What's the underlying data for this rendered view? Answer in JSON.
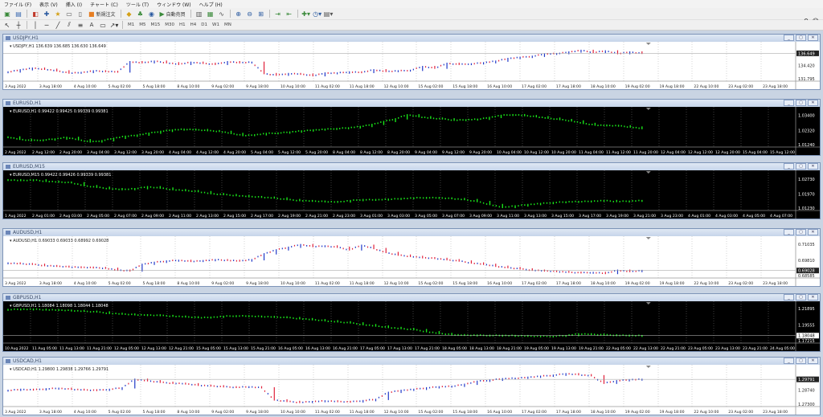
{
  "menu": [
    "ファイル (F)",
    "表示 (V)",
    "挿入 (I)",
    "チャート (C)",
    "ツール (T)",
    "ウィンドウ (W)",
    "ヘルプ (H)"
  ],
  "toolbar": {
    "new_order": "新規注文",
    "auto_trade": "自動売買",
    "timeframes": [
      "M1",
      "M5",
      "M15",
      "M30",
      "H1",
      "H4",
      "D1",
      "W1",
      "MN"
    ]
  },
  "charts": [
    {
      "title": "USDJPY,H1",
      "ohlc_label": "USDJPY,H1  136.639 136.685 136.630 136.649",
      "theme": "white",
      "prices": [
        "136.649",
        "134.420",
        "131.795"
      ],
      "current_price": "136.649",
      "x_labels": [
        "3 Aug 2022",
        "3 Aug 18:00",
        "4 Aug 10:00",
        "5 Aug 02:00",
        "5 Aug 18:00",
        "8 Aug 10:00",
        "9 Aug 02:00",
        "9 Aug 18:00",
        "10 Aug 10:00",
        "11 Aug 02:00",
        "11 Aug 18:00",
        "12 Aug 10:00",
        "15 Aug 02:00",
        "15 Aug 18:00",
        "16 Aug 10:00",
        "17 Aug 02:00",
        "17 Aug 18:00",
        "18 Aug 10:00",
        "19 Aug 02:00",
        "19 Aug 18:00",
        "22 Aug 10:00",
        "23 Aug 02:00",
        "23 Aug 18:00"
      ],
      "chart_data": {
        "type": "line",
        "series": [
          {
            "values": [
              133.2,
              133.6,
              133.9,
              133.7,
              133.4,
              133.0,
              133.1,
              133.4,
              133.3,
              133.2,
              135.1,
              134.9,
              135.2,
              134.9,
              134.6,
              135.0,
              134.8,
              134.6,
              135.1,
              134.9,
              135.0,
              132.9,
              132.6,
              132.9,
              132.8,
              132.5,
              133.0,
              133.0,
              133.2,
              133.1,
              133.6,
              133.3,
              133.4,
              133.5,
              134.2,
              133.9,
              134.8,
              134.6,
              134.7,
              134.9,
              135.2,
              135.7,
              135.9,
              136.1,
              136.5,
              136.6,
              136.9,
              137.2,
              136.8,
              137.1,
              136.6,
              136.9,
              136.649
            ]
          }
        ],
        "ylim": [
          131.795,
          137.6
        ]
      }
    },
    {
      "title": "EURUSD,H1",
      "ohlc_label": "EURUSD,H1  0.99422 0.99425 0.99339 0.99381",
      "theme": "black",
      "prices": [
        "1.03400",
        "1.02320",
        "1.01240"
      ],
      "current_price": "",
      "x_labels": [
        "2 Aug 2022",
        "2 Aug 12:00",
        "2 Aug 20:00",
        "3 Aug 04:00",
        "3 Aug 12:00",
        "3 Aug 20:00",
        "4 Aug 04:00",
        "4 Aug 12:00",
        "4 Aug 20:00",
        "5 Aug 04:00",
        "5 Aug 12:00",
        "5 Aug 20:00",
        "8 Aug 04:00",
        "8 Aug 12:00",
        "8 Aug 20:00",
        "9 Aug 04:00",
        "9 Aug 12:00",
        "9 Aug 20:00",
        "10 Aug 04:00",
        "10 Aug 12:00",
        "10 Aug 20:00",
        "11 Aug 04:00",
        "11 Aug 12:00",
        "11 Aug 20:00",
        "12 Aug 04:00",
        "12 Aug 12:00",
        "12 Aug 20:00",
        "15 Aug 04:00",
        "15 Aug 12:00"
      ],
      "chart_data": {
        "type": "line",
        "series": [
          {
            "values": [
              1.0185,
              1.0168,
              1.0159,
              1.0163,
              1.017,
              1.0182,
              1.0165,
              1.0149,
              1.0158,
              1.0175,
              1.019,
              1.0198,
              1.0212,
              1.0225,
              1.0235,
              1.024,
              1.0238,
              1.023,
              1.0225,
              1.021,
              1.0195,
              1.02,
              1.021,
              1.0213,
              1.022,
              1.0228,
              1.0235,
              1.024,
              1.0245,
              1.025,
              1.026,
              1.0275,
              1.0296,
              1.0315,
              1.0344,
              1.033,
              1.032,
              1.0315,
              1.0305,
              1.0308,
              1.0312,
              1.0325,
              1.034,
              1.0345,
              1.0338,
              1.033,
              1.032,
              1.031,
              1.03,
              1.0282,
              1.027,
              1.0268,
              1.0265,
              1.0256,
              1.0245
            ]
          }
        ],
        "ylim": [
          1.0124,
          1.0355
        ]
      }
    },
    {
      "title": "EURUSD,M15",
      "ohlc_label": "EURUSD,M15  0.99422 0.99426 0.99339 0.99381",
      "theme": "black",
      "prices": [
        "1.02730",
        "1.01970",
        "1.01230"
      ],
      "current_price": "",
      "x_labels": [
        "1 Aug 2022",
        "2 Aug 01:00",
        "2 Aug 03:00",
        "2 Aug 05:00",
        "2 Aug 07:00",
        "2 Aug 09:00",
        "2 Aug 11:00",
        "2 Aug 13:00",
        "2 Aug 15:00",
        "2 Aug 17:00",
        "2 Aug 19:00",
        "2 Aug 21:00",
        "2 Aug 23:00",
        "3 Aug 01:00",
        "3 Aug 03:00",
        "3 Aug 05:00",
        "3 Aug 07:00",
        "3 Aug 09:00",
        "3 Aug 11:00",
        "3 Aug 13:00",
        "3 Aug 15:00",
        "3 Aug 17:00",
        "3 Aug 19:00",
        "3 Aug 21:00",
        "3 Aug 23:00",
        "4 Aug 01:00",
        "4 Aug 03:00",
        "4 Aug 05:00",
        "4 Aug 07:00"
      ],
      "chart_data": {
        "type": "line",
        "series": [
          {
            "values": [
              1.027,
              1.0266,
              1.0269,
              1.0262,
              1.0258,
              1.0255,
              1.024,
              1.0232,
              1.0225,
              1.022,
              1.0225,
              1.0235,
              1.0228,
              1.022,
              1.0215,
              1.021,
              1.02,
              1.0195,
              1.019,
              1.0185,
              1.0182,
              1.0178,
              1.017,
              1.0165,
              1.0162,
              1.016,
              1.0158,
              1.0165,
              1.017,
              1.0168,
              1.0172,
              1.0175,
              1.0178,
              1.018,
              1.0178,
              1.0175,
              1.017,
              1.016,
              1.0145,
              1.013,
              1.0138,
              1.0145,
              1.015,
              1.0155,
              1.0158,
              1.016,
              1.0162,
              1.0165,
              1.016,
              1.0162,
              1.0165
            ]
          }
        ],
        "ylim": [
          1.0123,
          1.0285
        ]
      }
    },
    {
      "title": "AUDUSD,H1",
      "ohlc_label": "AUDUSD,H1  0.69033 0.69033 0.68992 0.69028",
      "theme": "white",
      "prices": [
        "0.71035",
        "0.69810",
        "0.69028",
        "0.68585"
      ],
      "current_price": "0.69028",
      "x_labels": [
        "3 Aug 2022",
        "3 Aug 18:00",
        "4 Aug 10:00",
        "5 Aug 02:00",
        "5 Aug 18:00",
        "8 Aug 10:00",
        "9 Aug 02:00",
        "9 Aug 18:00",
        "10 Aug 10:00",
        "11 Aug 02:00",
        "11 Aug 18:00",
        "12 Aug 10:00",
        "15 Aug 02:00",
        "15 Aug 18:00",
        "16 Aug 10:00",
        "17 Aug 02:00",
        "17 Aug 18:00",
        "18 Aug 10:00",
        "19 Aug 02:00",
        "19 Aug 18:00",
        "22 Aug 10:00",
        "23 Aug 02:00",
        "23 Aug 18:00"
      ],
      "chart_data": {
        "type": "line",
        "series": [
          {
            "values": [
              0.696,
              0.6955,
              0.695,
              0.694,
              0.6935,
              0.693,
              0.6928,
              0.6925,
              0.692,
              0.6905,
              0.69,
              0.695,
              0.6965,
              0.6975,
              0.698,
              0.6972,
              0.6978,
              0.6985,
              0.698,
              0.6975,
              0.6985,
              0.703,
              0.706,
              0.708,
              0.71,
              0.7085,
              0.709,
              0.708,
              0.706,
              0.7095,
              0.707,
              0.704,
              0.702,
              0.701,
              0.7,
              0.6995,
              0.6985,
              0.6975,
              0.696,
              0.695,
              0.6935,
              0.6925,
              0.6915,
              0.6905,
              0.69,
              0.6895,
              0.689,
              0.6885,
              0.6888,
              0.688,
              0.6905,
              0.6895,
              0.69028
            ]
          }
        ],
        "ylim": [
          0.6858,
          0.7115
        ]
      }
    },
    {
      "title": "GBPUSD,H1",
      "ohlc_label": "GBPUSD,H1  1.18084 1.18098 1.18044 1.18048",
      "theme": "black",
      "prices": [
        "1.21895",
        "1.19555",
        "1.18048",
        "1.17215"
      ],
      "current_price": "1.18048",
      "x_labels": [
        "10 Aug 2022",
        "11 Aug 05:00",
        "11 Aug 13:00",
        "11 Aug 21:00",
        "12 Aug 05:00",
        "12 Aug 13:00",
        "12 Aug 21:00",
        "15 Aug 05:00",
        "15 Aug 13:00",
        "15 Aug 21:00",
        "16 Aug 05:00",
        "16 Aug 13:00",
        "16 Aug 21:00",
        "17 Aug 05:00",
        "17 Aug 13:00",
        "17 Aug 21:00",
        "18 Aug 05:00",
        "18 Aug 13:00",
        "18 Aug 21:00",
        "19 Aug 05:00",
        "19 Aug 13:00",
        "19 Aug 21:00",
        "22 Aug 05:00",
        "22 Aug 13:00",
        "22 Aug 21:00",
        "23 Aug 05:00",
        "23 Aug 13:00",
        "23 Aug 21:00",
        "24 Aug 05:00"
      ],
      "chart_data": {
        "type": "line",
        "series": [
          {
            "values": [
              1.2175,
              1.218,
              1.2178,
              1.2172,
              1.2165,
              1.216,
              1.215,
              1.214,
              1.212,
              1.211,
              1.21,
              1.2098,
              1.209,
              1.208,
              1.207,
              1.206,
              1.2065,
              1.2078,
              1.2085,
              1.208,
              1.2075,
              1.207,
              1.206,
              1.2045,
              1.203,
              1.2015,
              1.2,
              1.1985,
              1.196,
              1.194,
              1.192,
              1.1905,
              1.189,
              1.186,
              1.1835,
              1.1818,
              1.1812,
              1.181,
              1.1808,
              1.1806,
              1.1805,
              1.18,
              1.1795,
              1.1798,
              1.1805,
              1.183,
              1.1825,
              1.1815,
              1.181,
              1.1805,
              1.18048
            ]
          }
        ],
        "ylim": [
          1.1722,
          1.22
        ]
      }
    },
    {
      "title": "USDCAD,H1",
      "ohlc_label": "USDCAD,H1  1.29800 1.29838 1.29766 1.29791",
      "theme": "white",
      "prices": [
        "1.29791",
        "1.28740",
        "1.27300"
      ],
      "current_price": "1.29791",
      "x_labels": [
        "3 Aug 2022",
        "3 Aug 18:00",
        "4 Aug 10:00",
        "5 Aug 02:00",
        "5 Aug 18:00",
        "8 Aug 10:00",
        "9 Aug 02:00",
        "9 Aug 18:00",
        "10 Aug 10:00",
        "11 Aug 02:00",
        "11 Aug 18:00",
        "12 Aug 10:00",
        "15 Aug 02:00",
        "15 Aug 18:00",
        "16 Aug 10:00",
        "17 Aug 02:00",
        "17 Aug 18:00",
        "18 Aug 10:00",
        "19 Aug 02:00",
        "19 Aug 18:00",
        "22 Aug 10:00",
        "23 Aug 02:00",
        "23 Aug 18:00"
      ],
      "chart_data": {
        "type": "line",
        "series": [
          {
            "values": [
              1.287,
              1.288,
              1.2875,
              1.2885,
              1.289,
              1.288,
              1.2875,
              1.287,
              1.288,
              1.2895,
              1.298,
              1.2965,
              1.295,
              1.294,
              1.2935,
              1.292,
              1.2915,
              1.2905,
              1.29,
              1.2905,
              1.2895,
              1.2775,
              1.276,
              1.275,
              1.2758,
              1.2765,
              1.276,
              1.2755,
              1.2768,
              1.278,
              1.285,
              1.287,
              1.288,
              1.2895,
              1.2905,
              1.291,
              1.293,
              1.296,
              1.297,
              1.2985,
              1.299,
              1.3,
              1.301,
              1.302,
              1.3035,
              1.3025,
              1.3015,
              1.294,
              1.2965,
              1.2975,
              1.29791
            ]
          }
        ],
        "ylim": [
          1.2725,
          1.306
        ]
      }
    }
  ],
  "colors": {
    "bull": "#1f38c8",
    "bear": "#e0203a",
    "green": "#19e619",
    "grid": "#8a8a8a",
    "titlebar": "#c6d5ea"
  },
  "icons": [
    "new-chart-icon",
    "profiles-icon",
    "crosshair-icon",
    "navigator-icon",
    "terminal-icon",
    "tester-icon",
    "new-order-icon",
    "auto-trading-icon",
    "zoom-in-icon",
    "zoom-out-icon",
    "tile-icon",
    "autoscroll-icon",
    "chart-shift-icon",
    "indicators-icon",
    "templates-icon",
    "period-icon"
  ]
}
